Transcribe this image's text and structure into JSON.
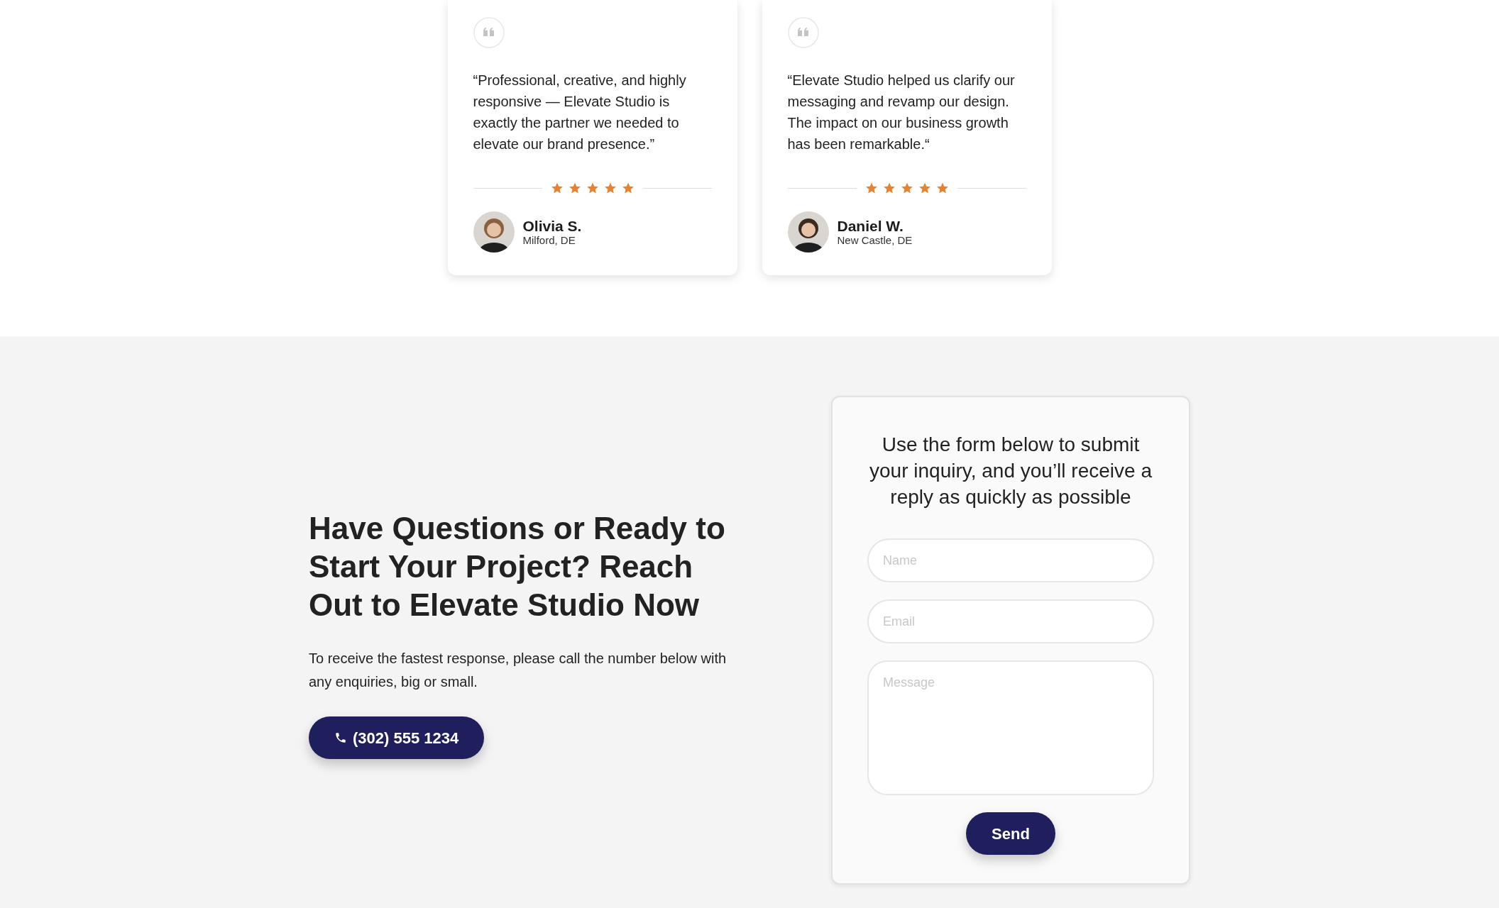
{
  "testimonials": [
    {
      "quote": "“Professional, creative, and highly responsive — Elevate Studio is exactly the partner we needed to elevate our brand presence.”",
      "stars": 5,
      "name": "Olivia S.",
      "location": "Milford, DE"
    },
    {
      "quote": "“Elevate Studio helped us clarify our messaging and revamp our design. The impact on our business growth has been remarkable.“",
      "stars": 5,
      "name": "Daniel W.",
      "location": "New Castle, DE"
    }
  ],
  "contact": {
    "heading": "Have Questions or Ready to Start Your Project? Reach Out to Elevate Studio Now",
    "text": "To receive the fastest response, please call the number below with any enquiries, big or small.",
    "phone_button": "(302) 555 1234"
  },
  "form": {
    "intro": "Use the form below to submit your inquiry, and you’ll receive a reply as quickly as possible",
    "fields": [
      {
        "kind": "input",
        "placeholder": "Name"
      },
      {
        "kind": "input",
        "placeholder": "Email"
      },
      {
        "kind": "textarea",
        "placeholder": "Message"
      }
    ],
    "submit": "Send"
  }
}
